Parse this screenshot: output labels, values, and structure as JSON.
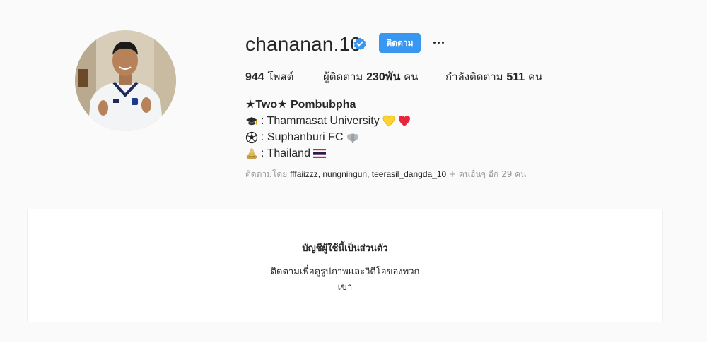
{
  "profile": {
    "username": "chananan.10",
    "follow_label": "ติดตาม",
    "posts_count": "944",
    "posts_label": "โพสต์",
    "followers_label": "ผู้ติดตาม",
    "followers_count": "230พัน",
    "followers_unit": "คน",
    "following_label": "กำลังติดตาม",
    "following_count": "511",
    "following_unit": "คน",
    "display_name": "★Two★ Pombubpha",
    "bio_lines": [
      {
        "icon": "graduation-cap-icon",
        "text": ": Thammasat University"
      },
      {
        "icon": "soccer-ball-icon",
        "text": ": Suphanburi FC"
      },
      {
        "icon": "buddha-icon",
        "text": ": Thailand"
      }
    ],
    "followed_by_label": "ติดตามโดย",
    "followed_by_names": "fffaiizzz, nungningun, teerasil_dangda_10",
    "followed_by_more": "+ คนอื่นๆ อีก 29 คน"
  },
  "private_notice": {
    "title": "บัญชีผู้ใช้นี้เป็นส่วนตัว",
    "subtitle": "ติดตามเพื่อดูรูปภาพและวิดีโอของพวกเขา"
  },
  "colors": {
    "background": "#fafafa",
    "accent": "#3897f0",
    "text": "#262626",
    "muted": "#999999"
  }
}
